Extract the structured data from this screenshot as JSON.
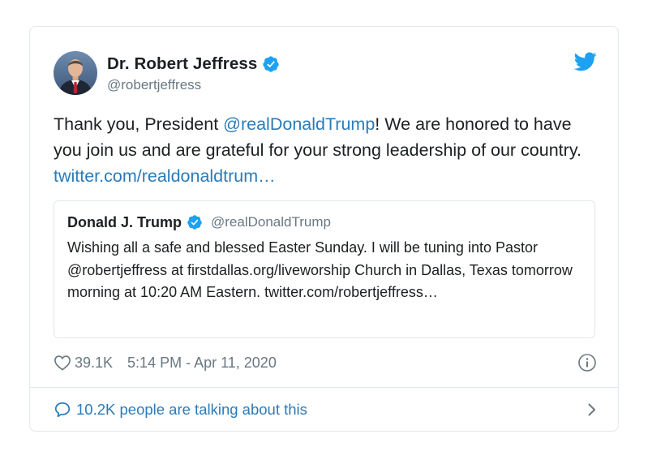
{
  "tweet": {
    "author_name": "Dr. Robert Jeffress",
    "author_handle": "@robertjeffress",
    "text_part1": "Thank you, President ",
    "mention": "@realDonaldTrump",
    "text_part2": "! We are honored to have you join us and are grateful for your strong leadership of our country. ",
    "link": "twitter.com/realdonaldtrum…",
    "likes": "39.1K",
    "timestamp": "5:14 PM - Apr 11, 2020"
  },
  "quoted": {
    "author_name": "Donald J. Trump",
    "author_handle": "@realDonaldTrump",
    "text": "Wishing all a safe and blessed Easter Sunday. I will be tuning into Pastor @robertjeffress at firstdallas.org/liveworship Church in Dallas, Texas tomorrow morning at 10:20 AM Eastern. twitter.com/robertjeffress…"
  },
  "footer": {
    "conversation": "10.2K people are talking about this"
  },
  "icons": {
    "verified": "verified-badge-icon",
    "brand": "twitter-bird-icon",
    "like": "heart-icon",
    "info": "info-icon",
    "reply": "speech-bubble-icon",
    "more": "chevron-right-icon"
  },
  "colors": {
    "link": "#2b7bb9",
    "twitter_blue": "#1da1f2",
    "secondary_text": "#697882",
    "border": "#e1e8ed"
  }
}
